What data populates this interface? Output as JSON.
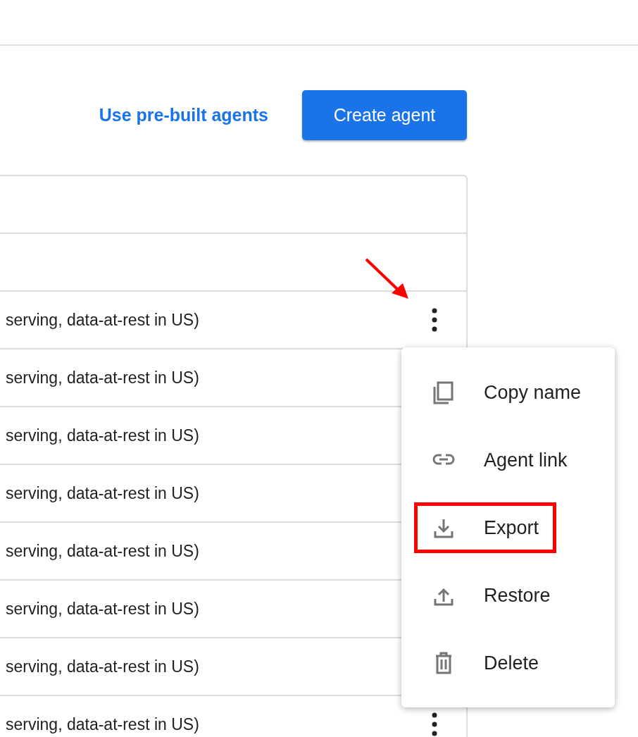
{
  "actions": {
    "link": "Use pre-built agents",
    "button": "Create agent"
  },
  "table": {
    "rows": [
      {
        "cell": "serving, data-at-rest in US)",
        "kebab": true
      },
      {
        "cell": "serving, data-at-rest in US)",
        "kebab": false
      },
      {
        "cell": "serving, data-at-rest in US)",
        "kebab": false
      },
      {
        "cell": "serving, data-at-rest in US)",
        "kebab": false
      },
      {
        "cell": "serving, data-at-rest in US)",
        "kebab": false
      },
      {
        "cell": "serving, data-at-rest in US)",
        "kebab": false
      },
      {
        "cell": "serving, data-at-rest in US)",
        "kebab": false
      },
      {
        "cell": "serving, data-at-rest in US)",
        "kebab": true
      }
    ]
  },
  "menu": {
    "items": [
      {
        "kind": "copy",
        "label": "Copy name",
        "highlighted": false
      },
      {
        "kind": "link",
        "label": "Agent link",
        "highlighted": false
      },
      {
        "kind": "export",
        "label": "Export",
        "highlighted": true
      },
      {
        "kind": "restore",
        "label": "Restore",
        "highlighted": false
      },
      {
        "kind": "delete",
        "label": "Delete",
        "highlighted": false
      }
    ]
  }
}
